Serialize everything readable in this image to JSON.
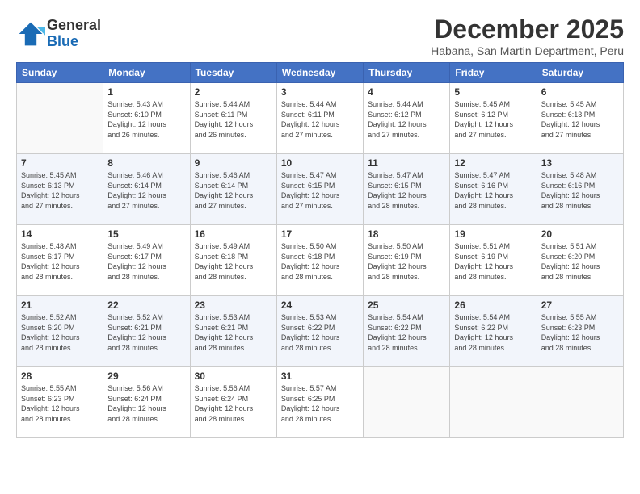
{
  "header": {
    "logo_line1": "General",
    "logo_line2": "Blue",
    "title": "December 2025",
    "subtitle": "Habana, San Martin Department, Peru"
  },
  "weekdays": [
    "Sunday",
    "Monday",
    "Tuesday",
    "Wednesday",
    "Thursday",
    "Friday",
    "Saturday"
  ],
  "weeks": [
    [
      {
        "num": "",
        "detail": ""
      },
      {
        "num": "1",
        "detail": "Sunrise: 5:43 AM\nSunset: 6:10 PM\nDaylight: 12 hours\nand 26 minutes."
      },
      {
        "num": "2",
        "detail": "Sunrise: 5:44 AM\nSunset: 6:11 PM\nDaylight: 12 hours\nand 26 minutes."
      },
      {
        "num": "3",
        "detail": "Sunrise: 5:44 AM\nSunset: 6:11 PM\nDaylight: 12 hours\nand 27 minutes."
      },
      {
        "num": "4",
        "detail": "Sunrise: 5:44 AM\nSunset: 6:12 PM\nDaylight: 12 hours\nand 27 minutes."
      },
      {
        "num": "5",
        "detail": "Sunrise: 5:45 AM\nSunset: 6:12 PM\nDaylight: 12 hours\nand 27 minutes."
      },
      {
        "num": "6",
        "detail": "Sunrise: 5:45 AM\nSunset: 6:13 PM\nDaylight: 12 hours\nand 27 minutes."
      }
    ],
    [
      {
        "num": "7",
        "detail": "Sunrise: 5:45 AM\nSunset: 6:13 PM\nDaylight: 12 hours\nand 27 minutes."
      },
      {
        "num": "8",
        "detail": "Sunrise: 5:46 AM\nSunset: 6:14 PM\nDaylight: 12 hours\nand 27 minutes."
      },
      {
        "num": "9",
        "detail": "Sunrise: 5:46 AM\nSunset: 6:14 PM\nDaylight: 12 hours\nand 27 minutes."
      },
      {
        "num": "10",
        "detail": "Sunrise: 5:47 AM\nSunset: 6:15 PM\nDaylight: 12 hours\nand 27 minutes."
      },
      {
        "num": "11",
        "detail": "Sunrise: 5:47 AM\nSunset: 6:15 PM\nDaylight: 12 hours\nand 28 minutes."
      },
      {
        "num": "12",
        "detail": "Sunrise: 5:47 AM\nSunset: 6:16 PM\nDaylight: 12 hours\nand 28 minutes."
      },
      {
        "num": "13",
        "detail": "Sunrise: 5:48 AM\nSunset: 6:16 PM\nDaylight: 12 hours\nand 28 minutes."
      }
    ],
    [
      {
        "num": "14",
        "detail": "Sunrise: 5:48 AM\nSunset: 6:17 PM\nDaylight: 12 hours\nand 28 minutes."
      },
      {
        "num": "15",
        "detail": "Sunrise: 5:49 AM\nSunset: 6:17 PM\nDaylight: 12 hours\nand 28 minutes."
      },
      {
        "num": "16",
        "detail": "Sunrise: 5:49 AM\nSunset: 6:18 PM\nDaylight: 12 hours\nand 28 minutes."
      },
      {
        "num": "17",
        "detail": "Sunrise: 5:50 AM\nSunset: 6:18 PM\nDaylight: 12 hours\nand 28 minutes."
      },
      {
        "num": "18",
        "detail": "Sunrise: 5:50 AM\nSunset: 6:19 PM\nDaylight: 12 hours\nand 28 minutes."
      },
      {
        "num": "19",
        "detail": "Sunrise: 5:51 AM\nSunset: 6:19 PM\nDaylight: 12 hours\nand 28 minutes."
      },
      {
        "num": "20",
        "detail": "Sunrise: 5:51 AM\nSunset: 6:20 PM\nDaylight: 12 hours\nand 28 minutes."
      }
    ],
    [
      {
        "num": "21",
        "detail": "Sunrise: 5:52 AM\nSunset: 6:20 PM\nDaylight: 12 hours\nand 28 minutes."
      },
      {
        "num": "22",
        "detail": "Sunrise: 5:52 AM\nSunset: 6:21 PM\nDaylight: 12 hours\nand 28 minutes."
      },
      {
        "num": "23",
        "detail": "Sunrise: 5:53 AM\nSunset: 6:21 PM\nDaylight: 12 hours\nand 28 minutes."
      },
      {
        "num": "24",
        "detail": "Sunrise: 5:53 AM\nSunset: 6:22 PM\nDaylight: 12 hours\nand 28 minutes."
      },
      {
        "num": "25",
        "detail": "Sunrise: 5:54 AM\nSunset: 6:22 PM\nDaylight: 12 hours\nand 28 minutes."
      },
      {
        "num": "26",
        "detail": "Sunrise: 5:54 AM\nSunset: 6:22 PM\nDaylight: 12 hours\nand 28 minutes."
      },
      {
        "num": "27",
        "detail": "Sunrise: 5:55 AM\nSunset: 6:23 PM\nDaylight: 12 hours\nand 28 minutes."
      }
    ],
    [
      {
        "num": "28",
        "detail": "Sunrise: 5:55 AM\nSunset: 6:23 PM\nDaylight: 12 hours\nand 28 minutes."
      },
      {
        "num": "29",
        "detail": "Sunrise: 5:56 AM\nSunset: 6:24 PM\nDaylight: 12 hours\nand 28 minutes."
      },
      {
        "num": "30",
        "detail": "Sunrise: 5:56 AM\nSunset: 6:24 PM\nDaylight: 12 hours\nand 28 minutes."
      },
      {
        "num": "31",
        "detail": "Sunrise: 5:57 AM\nSunset: 6:25 PM\nDaylight: 12 hours\nand 28 minutes."
      },
      {
        "num": "",
        "detail": ""
      },
      {
        "num": "",
        "detail": ""
      },
      {
        "num": "",
        "detail": ""
      }
    ]
  ]
}
